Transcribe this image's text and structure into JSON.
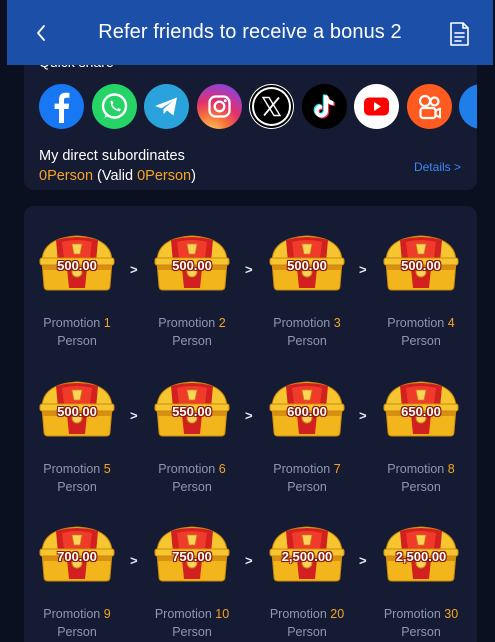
{
  "header": {
    "title": "Refer friends to receive a bonus 2"
  },
  "share": {
    "label": "Quick share",
    "icons": [
      "facebook-icon",
      "whatsapp-icon",
      "telegram-icon",
      "instagram-icon",
      "x-icon",
      "tiktok-icon",
      "youtube-icon",
      "kuaishou-icon",
      "more-icon"
    ]
  },
  "subordinates": {
    "title": "My direct subordinates",
    "count": "0Person",
    "valid_prefix": " (Valid ",
    "valid_count": "0Person",
    "valid_suffix": ")",
    "details": "Details >"
  },
  "promotions": {
    "label": "Promotion",
    "unit": "Person",
    "arrow": ">",
    "items": [
      {
        "amount": "500.00",
        "count": "1"
      },
      {
        "amount": "500.00",
        "count": "2"
      },
      {
        "amount": "500.00",
        "count": "3"
      },
      {
        "amount": "500.00",
        "count": "4"
      },
      {
        "amount": "500.00",
        "count": "5"
      },
      {
        "amount": "550.00",
        "count": "6"
      },
      {
        "amount": "600.00",
        "count": "7"
      },
      {
        "amount": "650.00",
        "count": "8"
      },
      {
        "amount": "700.00",
        "count": "9"
      },
      {
        "amount": "750.00",
        "count": "10"
      },
      {
        "amount": "2,500.00",
        "count": "20"
      },
      {
        "amount": "2,500.00",
        "count": "30"
      }
    ]
  },
  "colors": {
    "header": "#1b4fa8",
    "card": "#151b33",
    "accent": "#f5a524",
    "link": "#3d87f5"
  }
}
